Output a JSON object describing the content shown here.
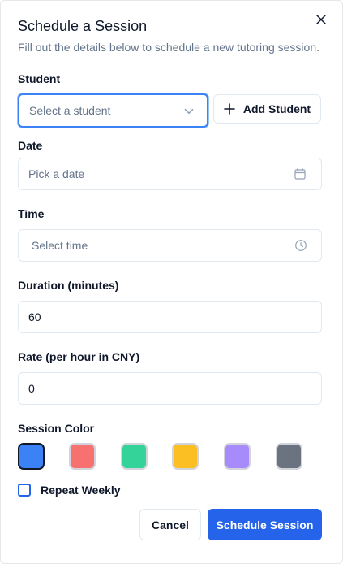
{
  "dialog": {
    "title": "Schedule a Session",
    "description": "Fill out the details below to schedule a new tutoring session.",
    "close_icon": "close-icon"
  },
  "student": {
    "label": "Student",
    "placeholder": "Select a student",
    "dropdown_icon": "chevron-down-icon",
    "add_button_label": "Add Student",
    "add_icon": "plus-icon"
  },
  "date": {
    "label": "Date",
    "placeholder": "Pick a date",
    "icon": "calendar-icon"
  },
  "time": {
    "label": "Time",
    "placeholder": "Select time",
    "icon": "clock-icon"
  },
  "duration": {
    "label": "Duration (minutes)",
    "value": "60"
  },
  "rate": {
    "label": "Rate (per hour in CNY)",
    "value": "0"
  },
  "session_color": {
    "label": "Session Color",
    "selected_index": 0,
    "colors": [
      "#3b82f6",
      "#f87171",
      "#34d399",
      "#fbbf24",
      "#a78bfa",
      "#6b7280"
    ]
  },
  "repeat": {
    "label": "Repeat Weekly",
    "checked": false
  },
  "footer": {
    "cancel_label": "Cancel",
    "submit_label": "Schedule Session"
  },
  "theme": {
    "primary": "#2563eb",
    "focus_ring": "#3b82f6",
    "muted_text": "#64748b",
    "border": "#e2e8f0"
  }
}
